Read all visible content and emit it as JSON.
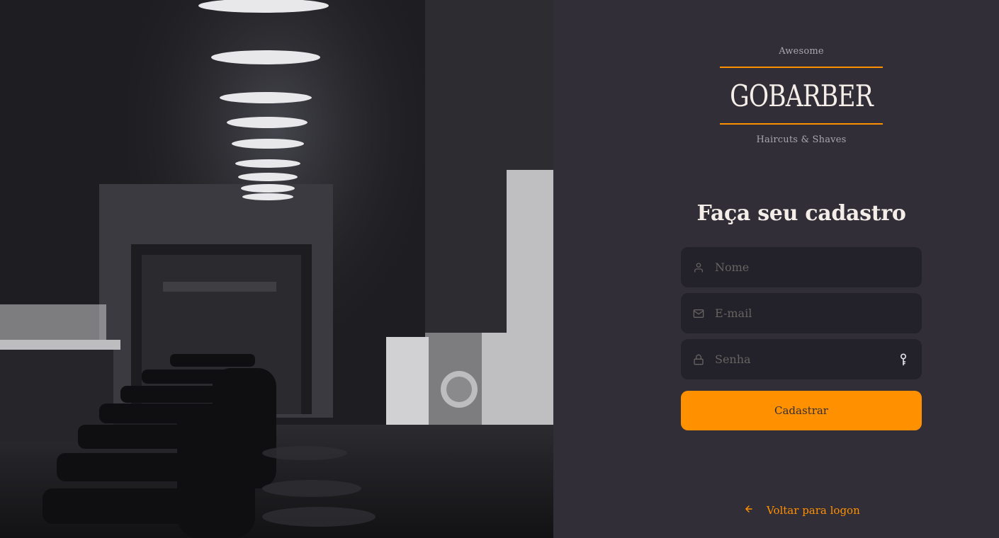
{
  "hero_image": {
    "description_icon": "barbershop-photo"
  },
  "logo": {
    "top": "Awesome",
    "word": "GOBARBER",
    "bottom": "Haircuts & Shaves"
  },
  "form": {
    "title": "Faça seu cadastro",
    "name_placeholder": "Nome",
    "email_placeholder": "E-mail",
    "password_placeholder": "Senha",
    "submit_label": "Cadastrar"
  },
  "footer": {
    "back_label": "Voltar para logon"
  },
  "icons": {
    "name": "user-icon",
    "email": "mail-icon",
    "password": "lock-icon",
    "reveal": "key-icon",
    "back": "arrow-left-icon"
  },
  "colors": {
    "background": "#312e38",
    "input_bg": "#232129",
    "accent": "#ff9000",
    "text": "#f4ede8",
    "muted": "#666360"
  }
}
